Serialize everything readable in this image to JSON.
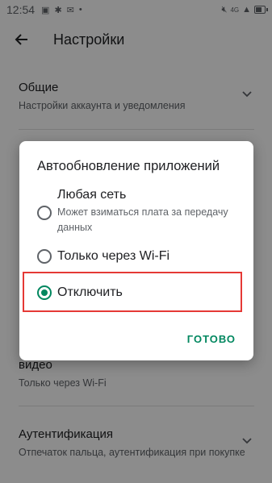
{
  "status_bar": {
    "time": "12:54",
    "network_label": "4G"
  },
  "app_bar": {
    "title": "Настройки"
  },
  "settings": {
    "general": {
      "title": "Общие",
      "subtitle": "Настройки аккаунта и уведомления"
    },
    "video": {
      "title": "видео",
      "subtitle": "Только через Wi-Fi"
    },
    "authentication": {
      "title": "Аутентификация",
      "subtitle": "Отпечаток пальца, аутентификация при покупке"
    }
  },
  "dialog": {
    "title": "Автообновление приложений",
    "options": [
      {
        "label": "Любая сеть",
        "description": "Может взиматься плата за передачу данных",
        "selected": false
      },
      {
        "label": "Только через Wi-Fi",
        "description": "",
        "selected": false
      },
      {
        "label": "Отключить",
        "description": "",
        "selected": true
      }
    ],
    "done_label": "ГОТОВО"
  },
  "colors": {
    "accent": "#01875f",
    "highlight": "#e53935"
  }
}
